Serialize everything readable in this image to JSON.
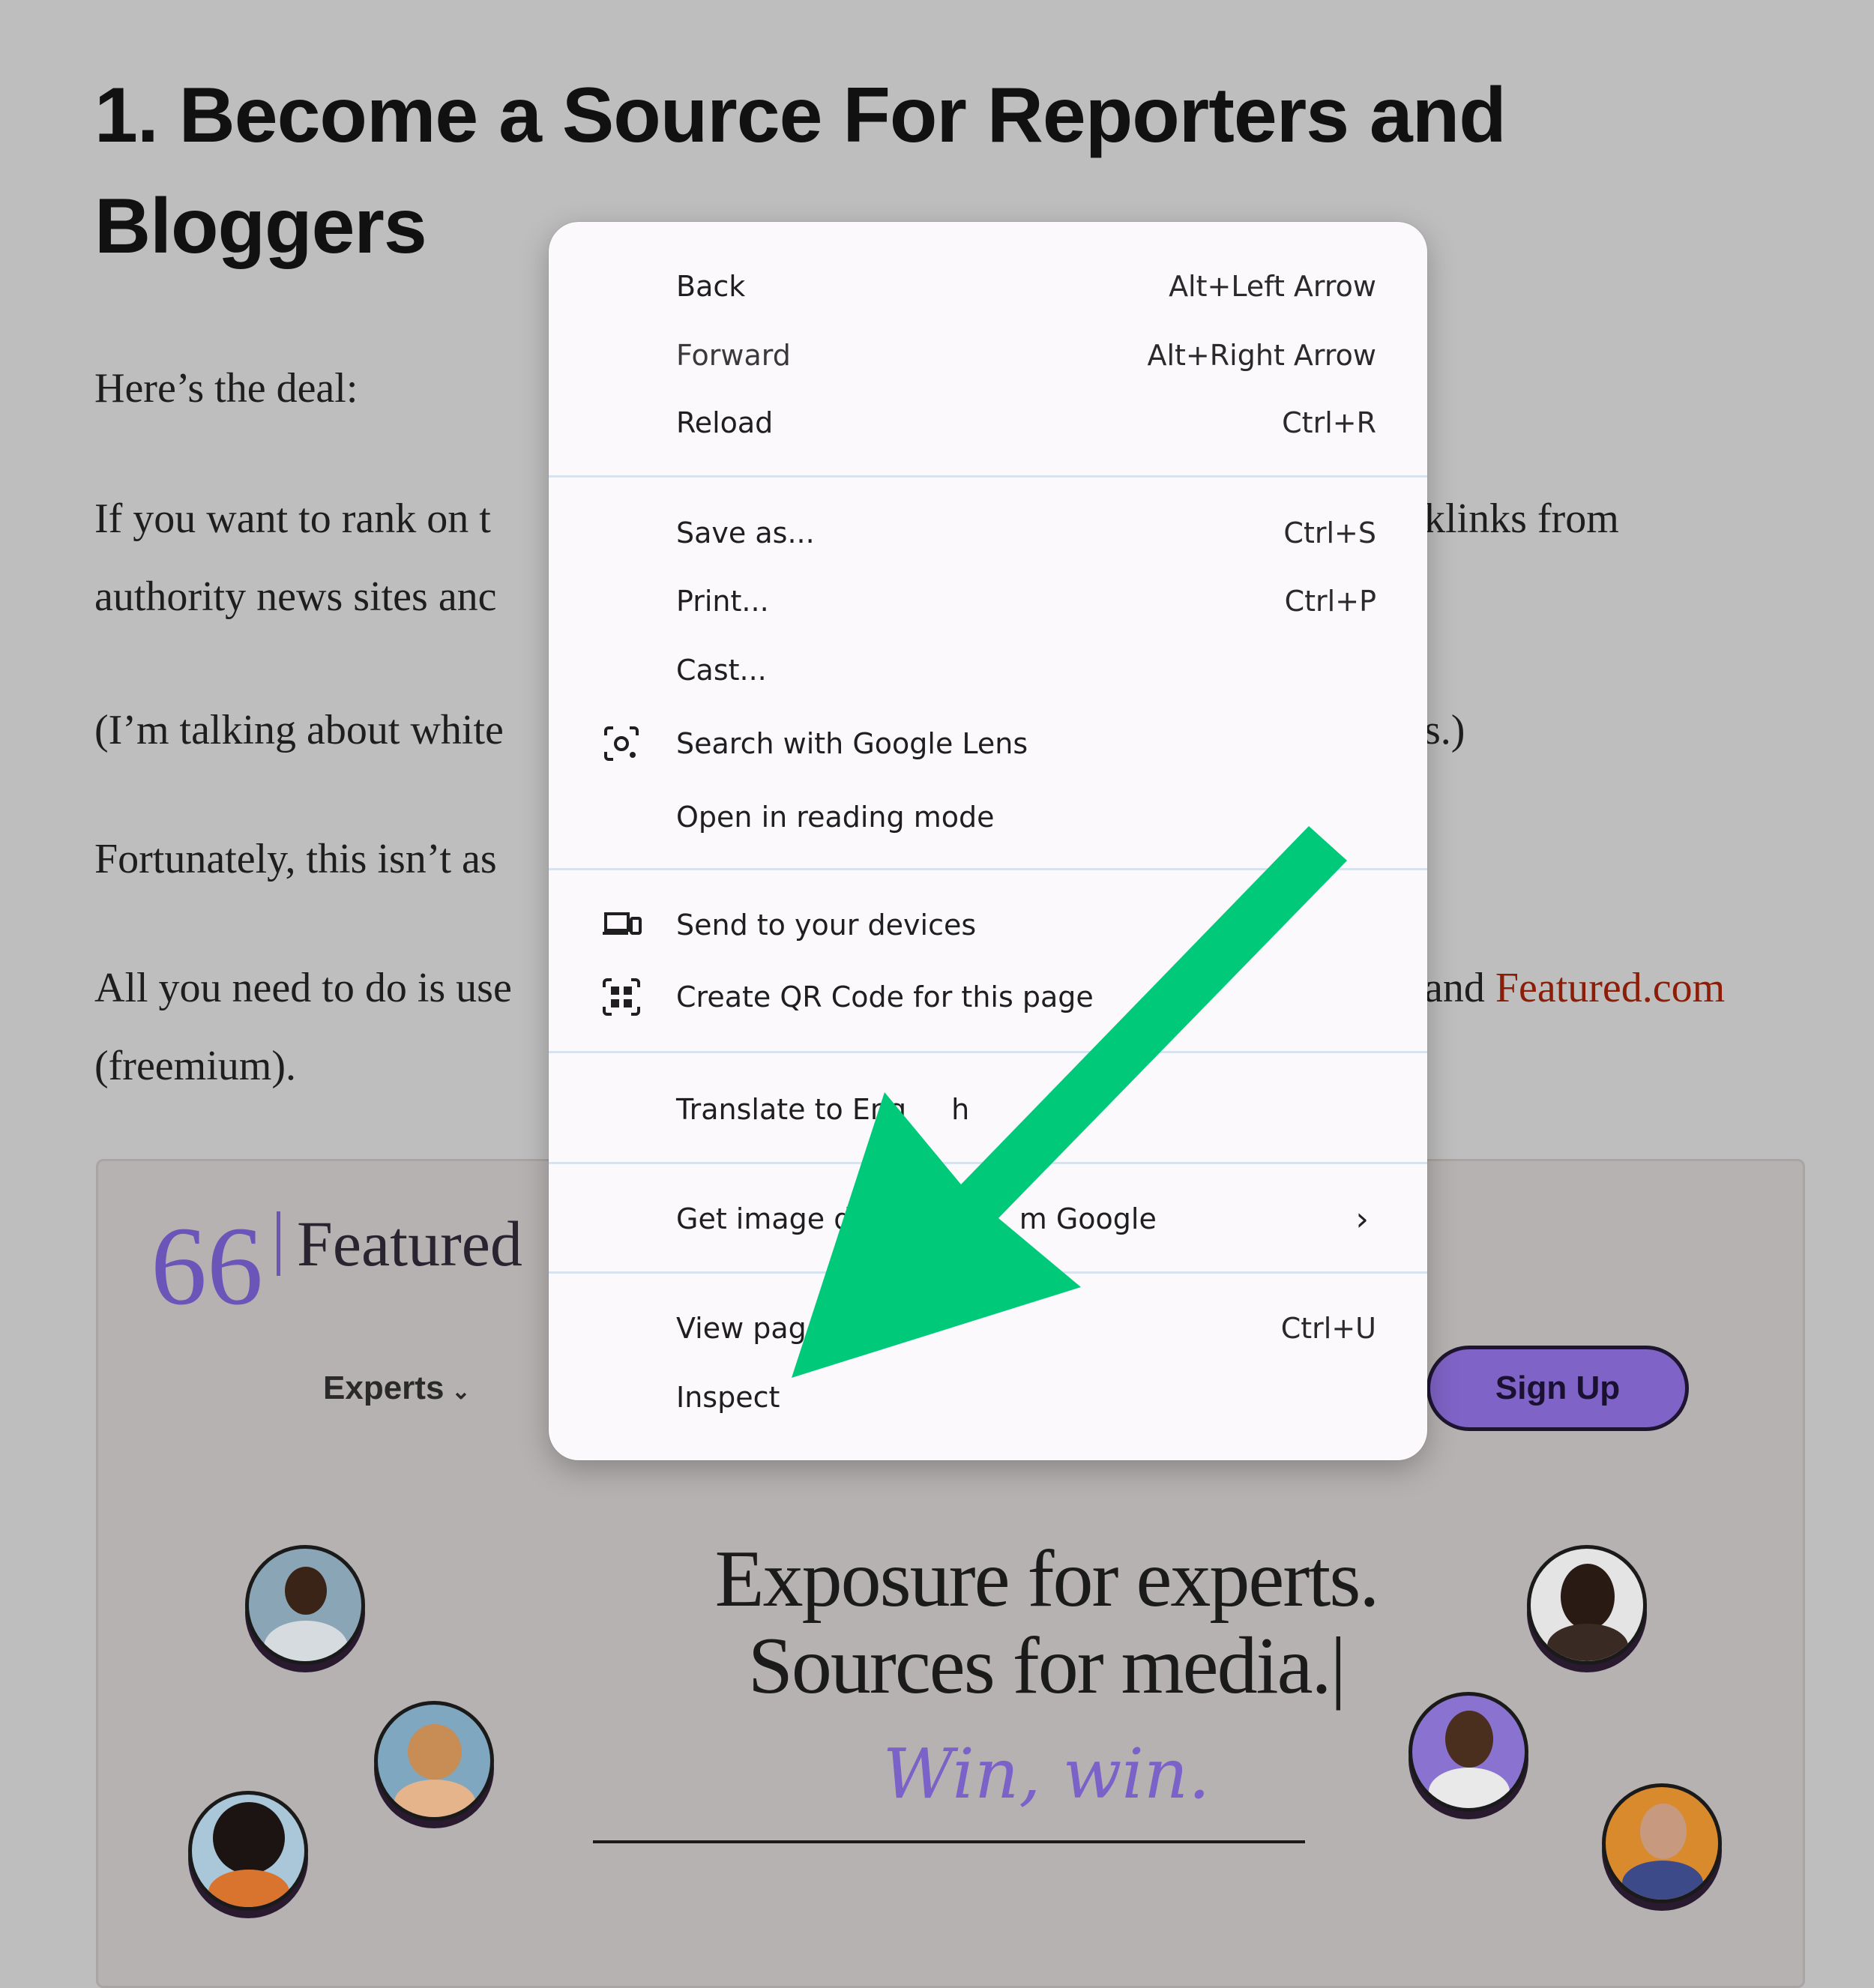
{
  "article": {
    "heading": "1. Become a Source For Reporters and Bloggers",
    "p1": "Here’s the deal:",
    "p2_line1_left": "If you want to rank on t",
    "p2_line1_right": "klinks from",
    "p2_line2_left": "authority news sites anc",
    "p3_left": "(I’m talking about white",
    "p3_right": "s.)",
    "p4_left": "Fortunately, this isn’t as",
    "p5_line1_left": "All you need to do is use",
    "p5_line1_right_text": "and",
    "p5_link": "Featured.com",
    "p5_line2": "(freemium)."
  },
  "embedded_site": {
    "logo_quote": "66",
    "logo_text": "Featured",
    "nav_experts": "Experts",
    "nav_chevron": "⌄",
    "signup_button": "Sign Up",
    "hero_line1": "Exposure for experts.",
    "hero_line2": "Sources for media.|",
    "hero_tagline": "Win, win."
  },
  "context_menu": {
    "back": {
      "label": "Back",
      "shortcut": "Alt+Left Arrow"
    },
    "forward": {
      "label": "Forward",
      "shortcut": "Alt+Right Arrow"
    },
    "reload": {
      "label": "Reload",
      "shortcut": "Ctrl+R"
    },
    "save_as": {
      "label": "Save as...",
      "shortcut": "Ctrl+S"
    },
    "print": {
      "label": "Print...",
      "shortcut": "Ctrl+P"
    },
    "cast": {
      "label": "Cast..."
    },
    "google_lens": {
      "label": "Search with Google Lens",
      "icon": "google-lens-icon"
    },
    "reading_mode": {
      "label": "Open in reading mode"
    },
    "send_devices": {
      "label": "Send to your devices",
      "icon": "devices-icon"
    },
    "qr_code": {
      "label": "Create QR Code for this page",
      "icon": "qr-code-icon"
    },
    "translate": {
      "label": "Translate to Eng",
      "label_tail": "h"
    },
    "image_desc": {
      "label": "Get image de",
      "label_tail": "m Google",
      "submenu": "›"
    },
    "view_source": {
      "label": "View page",
      "shortcut": "Ctrl+U"
    },
    "inspect": {
      "label": "Inspect"
    }
  },
  "colors": {
    "page_overlay": "#bebebe",
    "menu_background": "#fbf9fc",
    "arrow_green": "#00c97a",
    "link_red": "#8c1d07",
    "featured_purple": "#7f63c6"
  }
}
